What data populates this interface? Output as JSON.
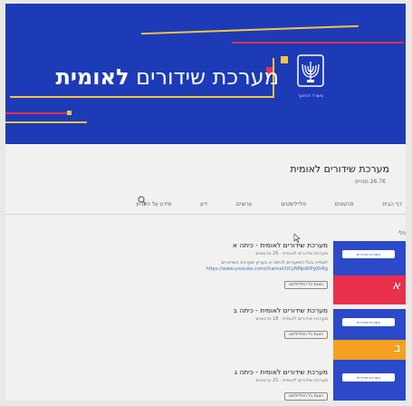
{
  "banner": {
    "title_regular": "מערכת שידורים",
    "title_bold": "לאומית",
    "ministry_text": "משרד החינוך",
    "colors": {
      "background": "#1d3bb7",
      "accent_yellow": "#f4c542",
      "accent_red": "#e8304c"
    }
  },
  "channel": {
    "name": "מערכת שידורים לאומית",
    "subscribers": "26.7K מנויים"
  },
  "tabs": [
    {
      "label": "דף הבית"
    },
    {
      "label": "סרטונים"
    },
    {
      "label": "פלייליסטים"
    },
    {
      "label": "ערוצים"
    },
    {
      "label": "דיון"
    },
    {
      "label": "מידע על הערוץ"
    }
  ],
  "side_label": "פלי",
  "videos": [
    {
      "title": "מערכת שידורים לאומית - כיתה א",
      "meta": "מערכת שידורים לאומית · 26 סרטונים",
      "desc": "לצפייה בכל השיעורים לכיתה א בערוץ מערכת השידורים",
      "link": "https://www.youtube.com/channel/UCyNMpd0PgXhRg",
      "button": "הצגת כל הפלייליסט",
      "grade": "א",
      "stripe_color": "#e8304c"
    },
    {
      "title": "מערכת שידורים לאומית - כיתה ב",
      "meta": "מערכת שידורים לאומית · 18 סרטונים",
      "desc": "",
      "link": "",
      "button": "הצגת כל הפלייליסט",
      "grade": "ב",
      "stripe_color": "#f4a020"
    },
    {
      "title": "מערכת שידורים לאומית - כיתה ג",
      "meta": "מערכת שידורים לאומית · 21 סרטונים",
      "desc": "",
      "link": "",
      "button": "הצגת כל הפלייליסט",
      "grade": "",
      "stripe_color": "#2b49c8"
    }
  ]
}
